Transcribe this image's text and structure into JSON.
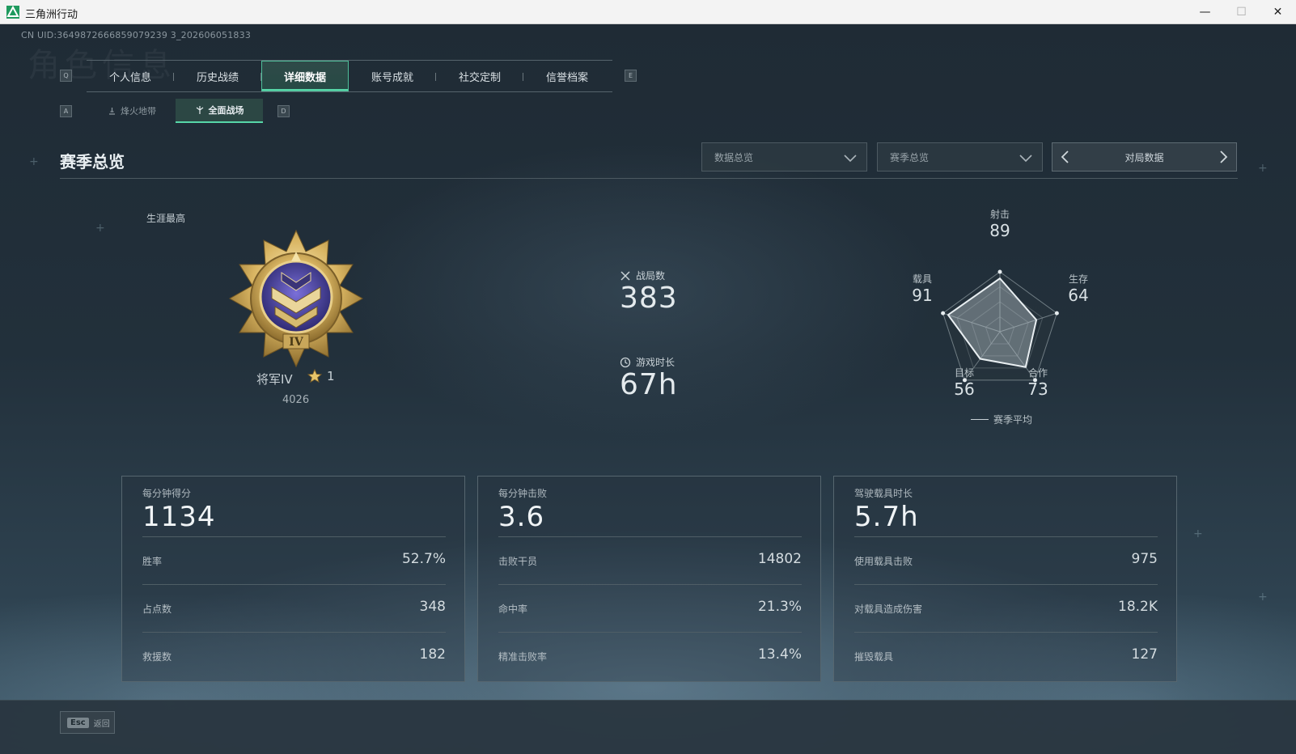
{
  "window": {
    "title": "三角洲行动",
    "minimize": "—",
    "maximize": "☐",
    "close": "✕",
    "app_icon": "delta-logo-icon"
  },
  "header": {
    "uid": "CN UID:3649872666859079239 3_202606051833",
    "watermark": "角色信息"
  },
  "key_hints": {
    "prev_tab": "Q",
    "next_tab": "E",
    "prev_sub": "A",
    "next_sub": "D"
  },
  "tabs": [
    {
      "label": "个人信息",
      "active": false
    },
    {
      "label": "历史战绩",
      "active": false
    },
    {
      "label": "详细数据",
      "active": true
    },
    {
      "label": "账号成就",
      "active": false
    },
    {
      "label": "社交定制",
      "active": false
    },
    {
      "label": "信誉档案",
      "active": false
    }
  ],
  "subtabs": [
    {
      "label": "烽火地带",
      "icon": "beacon-icon",
      "active": false
    },
    {
      "label": "全面战场",
      "icon": "battlefield-icon",
      "active": true
    }
  ],
  "section": {
    "title": "赛季总览",
    "dropdown1": "数据总览",
    "dropdown2": "赛季总览",
    "match_data": "对局数据"
  },
  "rank": {
    "career_label": "生涯最高",
    "name": "将军IV",
    "stars": "1",
    "score": "4026",
    "badge_icon": "general-rank-badge-icon"
  },
  "mid_stats": {
    "matches_label": "战局数",
    "matches_value": "383",
    "playtime_label": "游戏时长",
    "playtime_value": "67h"
  },
  "radar": {
    "axes": [
      {
        "label": "射击",
        "value": "89"
      },
      {
        "label": "生存",
        "value": "64"
      },
      {
        "label": "合作",
        "value": "73"
      },
      {
        "label": "目标",
        "value": "56"
      },
      {
        "label": "载具",
        "value": "91"
      }
    ],
    "legend": "赛季平均"
  },
  "cards": [
    {
      "title": "每分钟得分",
      "value": "1134",
      "rows": [
        {
          "label": "胜率",
          "value": "52.7%"
        },
        {
          "label": "占点数",
          "value": "348"
        },
        {
          "label": "救援数",
          "value": "182"
        }
      ]
    },
    {
      "title": "每分钟击败",
      "value": "3.6",
      "rows": [
        {
          "label": "击败干员",
          "value": "14802"
        },
        {
          "label": "命中率",
          "value": "21.3%"
        },
        {
          "label": "精准击败率",
          "value": "13.4%"
        }
      ]
    },
    {
      "title": "驾驶载具时长",
      "value": "5.7h",
      "rows": [
        {
          "label": "使用载具击败",
          "value": "975"
        },
        {
          "label": "对载具造成伤害",
          "value": "18.2K"
        },
        {
          "label": "摧毁载具",
          "value": "127"
        }
      ]
    }
  ],
  "footer": {
    "esc_key": "Esc",
    "back_label": "返回"
  },
  "colors": {
    "accent": "#57d6a8",
    "background": "#1f2b35"
  }
}
